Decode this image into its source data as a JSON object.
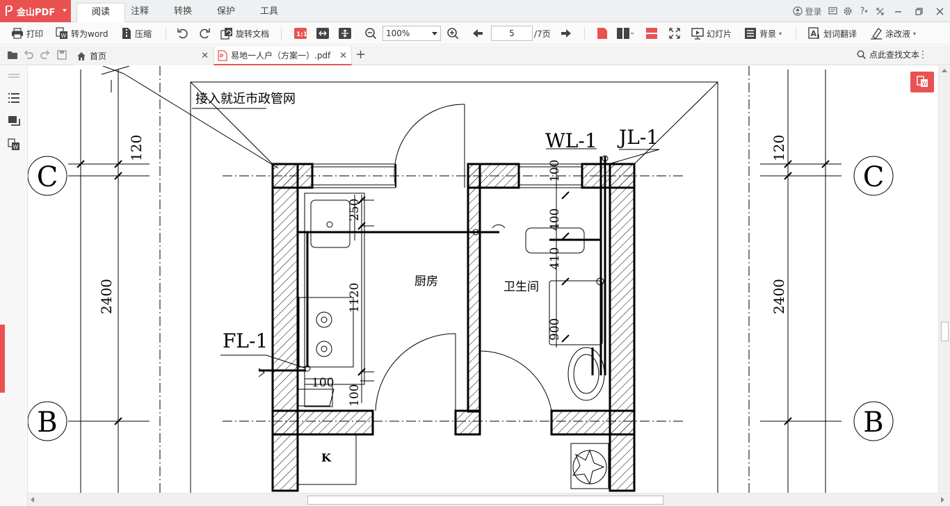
{
  "app": {
    "name": "金山PDF"
  },
  "menu": {
    "tabs": [
      "阅读",
      "注释",
      "转换",
      "保护",
      "工具"
    ],
    "active": "阅读"
  },
  "topright": {
    "login": "登录"
  },
  "toolbar": {
    "print": "打印",
    "to_word": "转为word",
    "compress": "压缩",
    "rotate_doc": "旋转文档",
    "zoom": "100%",
    "page_current": "5",
    "page_total": "/7页",
    "slideshow": "幻灯片",
    "background": "背景",
    "translate": "划词翻译",
    "whiteout": "涂改液"
  },
  "tabs": {
    "home": "首页",
    "file": "易地一人户（方案一）.pdf",
    "search": "点此查找文本"
  },
  "drawing": {
    "note_municipal": "接入就近市政管网",
    "wl": "WL-1",
    "jl": "JL-1",
    "fl": "FL-1",
    "kitchen": "厨房",
    "bathroom": "卫生间",
    "axis_c": "C",
    "axis_b": "B",
    "dim_120": "120",
    "dim_2400": "2400",
    "dim_250": "250",
    "dim_1120": "1120",
    "dim_100": "100",
    "dim_400": "400",
    "dim_410": "410",
    "dim_900": "900",
    "mark_k": "K"
  },
  "colors": {
    "accent": "#e85352"
  }
}
